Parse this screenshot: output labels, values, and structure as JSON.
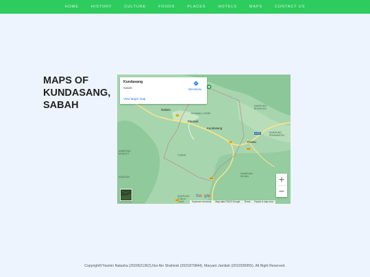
{
  "nav": {
    "items": [
      "HOME",
      "HISTORY",
      "CULTURE",
      "FOODS",
      "PLACES",
      "HOTELS",
      "MAPS",
      "CONTACT US"
    ]
  },
  "page": {
    "heading_line1": "MAPS OF",
    "heading_line2": "KUNDASANG,",
    "heading_line3": "SABAH"
  },
  "map": {
    "info_title": "Kundasang",
    "info_subtitle": "Sabah",
    "view_larger": "View larger map",
    "directions": "Directions",
    "places": {
      "nabalu": "Nabalu",
      "kundasang": "Kundasang",
      "ranau": "Ranau",
      "pinosuk": "Pinosuk"
    },
    "small_places": {
      "kinabalu_park": "KINABALU PARK",
      "kampung_mohigit": "KAMPUNG\nMOHIGIT",
      "tudan": "TUDAN",
      "kampung_bongkud": "KAMPUNG\nBONGKUD",
      "kampung_kilimu": "KAMPUNG\nKILIMU",
      "kampung_pinawantai": "KAMPUNG\nPINAWANTAI",
      "dongor": "DONGOR",
      "kampung_toboh": "KAMPUNG\nTOBOH\nLAMA"
    },
    "roads": {
      "r22_a": "22",
      "r22_b": "22",
      "a_road": "A4Z6",
      "r500_a": "500",
      "r500_b": "500",
      "r500_c": "500"
    },
    "zoom_in": "+",
    "zoom_out": "−",
    "attribution": {
      "shortcuts": "Keyboard shortcuts",
      "map_data": "Map data ©2023 Google",
      "terms": "Terms",
      "report": "Report a map error"
    },
    "colors": {
      "terrain": "#9fd1a8",
      "boundary": "#b8838f",
      "roads": "#f5e48b"
    }
  },
  "footer": {
    "text": "Copyright©Yasmin Natasha (2020621362),Nur Ain Shahirah (2021870844), Maryam Jamilah (2019335955). All Right Reserved."
  }
}
